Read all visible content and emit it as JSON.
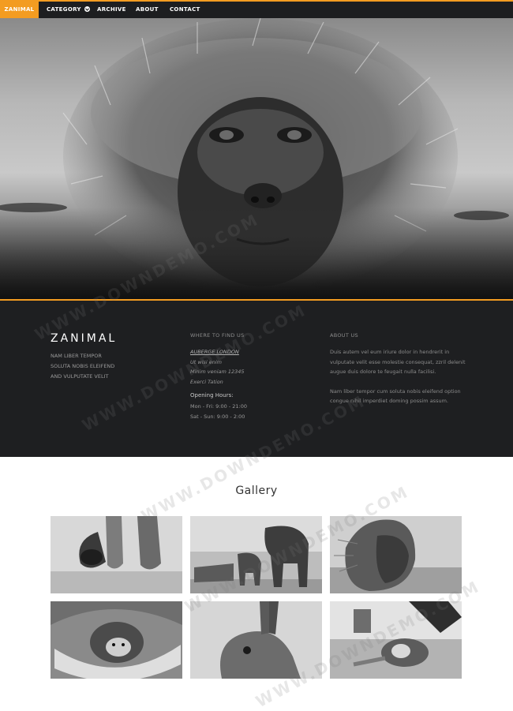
{
  "nav": {
    "brand": "ZANIMAL",
    "items": [
      {
        "label": "CATEGORY",
        "has_dropdown": true
      },
      {
        "label": "ARCHIVE"
      },
      {
        "label": "ABOUT"
      },
      {
        "label": "CONTACT"
      }
    ],
    "accent_color": "#f39c21"
  },
  "hero": {
    "image": "monkey-portrait-bw"
  },
  "info": {
    "brand_title": "ZANIMAL",
    "brand_tagline_lines": [
      "NAM LIBER TEMPOR",
      "SOLUTA NOBIS ELEIFEND",
      "AND VULPUTATE VELIT"
    ],
    "where_heading": "WHERE TO FIND US",
    "address_lines": [
      "AUBERGE LONDON",
      "Ut wisi enim",
      "Minim veniam 12345",
      "Exerci Tation"
    ],
    "hours_heading": "Opening Hours:",
    "hours_lines": [
      "Mon - Fri: 9:00 - 21:00",
      "Sat - Sun: 9:00 - 2:00"
    ],
    "about_heading": "ABOUT US",
    "about_paragraphs": [
      "Duis autem vel eum iriure dolor in hendrerit in vulputate velit esse molestie consequat, zzril delenit augue duis dolore te feugait nulla facilisi.",
      "Nam liber tempor cum soluta nobis eleifend option congue nihil imperdiet doming possim assum."
    ]
  },
  "gallery": {
    "title": "Gallery",
    "images": [
      "cat-paws",
      "elephant-herd",
      "lion-wind",
      "hedgehog",
      "hare",
      "cat-playing"
    ]
  },
  "watermark": [
    "WWW.DOWNDEMO.COM",
    "WWW.DOWNDEMO.COM",
    "WWW.DOWNDEMO.COM",
    "WWW.DOWNDEMO.COM",
    "WWW.DOWNDEMO.COM"
  ]
}
